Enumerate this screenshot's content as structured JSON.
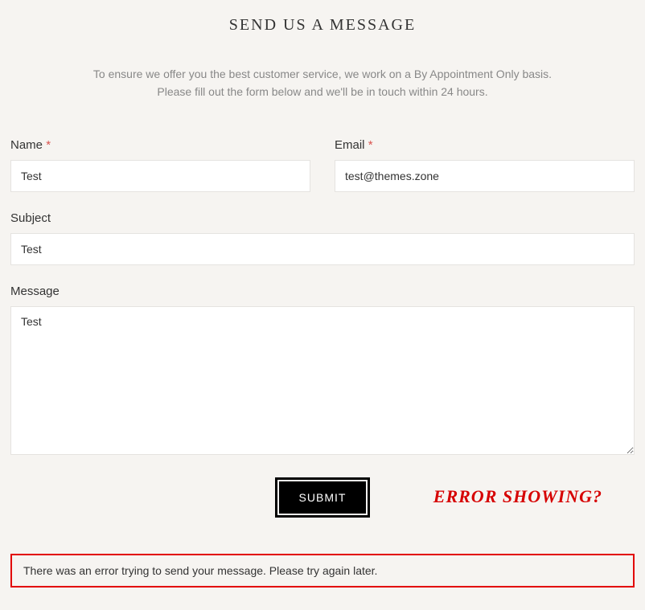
{
  "heading": "SEND US A MESSAGE",
  "intro_line1": "To ensure we offer you the best customer service, we work on a By Appointment Only basis.",
  "intro_line2": "Please fill out the form below and we'll be in touch within 24 hours.",
  "fields": {
    "name": {
      "label": "Name",
      "required_mark": "*",
      "value": "Test"
    },
    "email": {
      "label": "Email",
      "required_mark": "*",
      "value": "test@themes.zone"
    },
    "subject": {
      "label": "Subject",
      "value": "Test"
    },
    "message": {
      "label": "Message",
      "value": "Test"
    }
  },
  "submit_label": "SUBMIT",
  "annotation": "ERROR SHOWING?",
  "error_message": "There was an error trying to send your message. Please try again later."
}
